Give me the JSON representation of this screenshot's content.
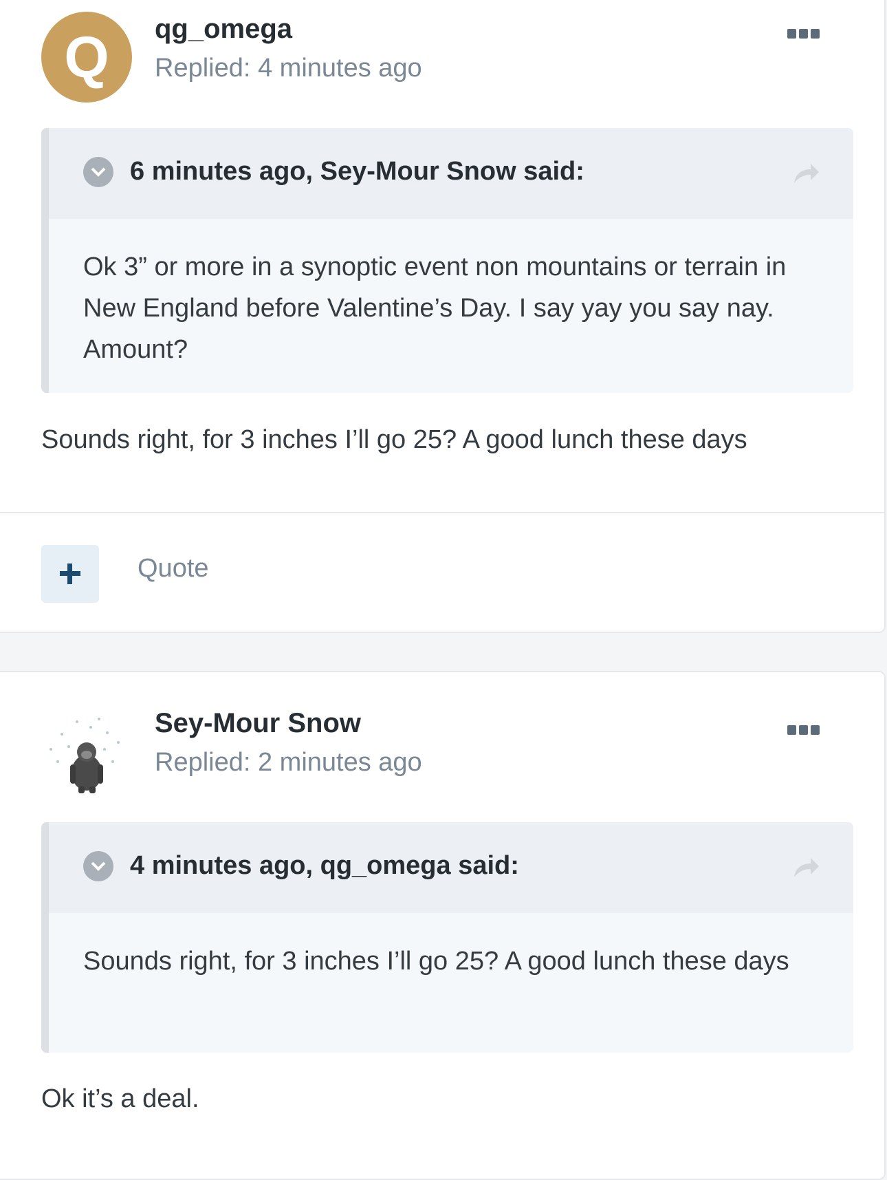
{
  "posts": [
    {
      "author": "qg_omega",
      "avatar_letter": "Q",
      "meta": "Replied: 4 minutes ago",
      "quote": {
        "cite": "6 minutes ago, Sey-Mour Snow said:",
        "body": "Ok 3” or more in a synoptic event non mountains or terrain in New England before Valentine’s Day. I say yay you say nay. Amount?"
      },
      "text": "Sounds right, for 3 inches I’ll go 25?  A good lunch these days",
      "actions": {
        "quote_label": "Quote"
      }
    },
    {
      "author": "Sey-Mour Snow",
      "avatar_icon": "gorilla-snow-avatar",
      "meta": "Replied: 2 minutes ago",
      "quote": {
        "cite": "4 minutes ago, qg_omega said:",
        "body": "Sounds right, for 3 inches I’ll go 25?  A good lunch these days"
      },
      "text": "Ok it’s a deal."
    }
  ],
  "colors": {
    "accent_avatar": "#c9a05e",
    "meta_text": "#7a8896",
    "plus_icon": "#1c4b72"
  }
}
